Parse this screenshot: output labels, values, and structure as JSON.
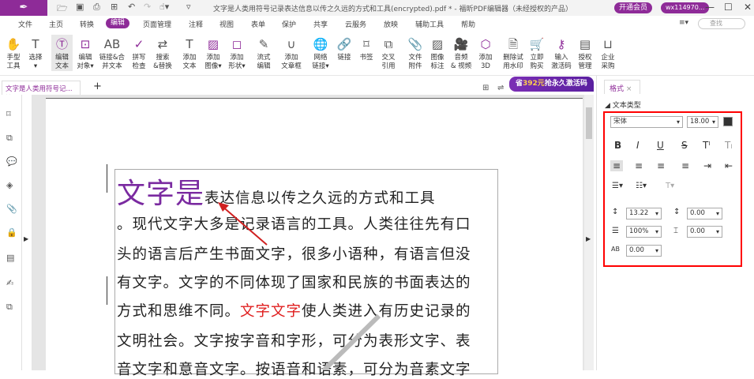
{
  "titlebar": {
    "title": "文字是人类用符号记录表达信息以传之久远的方式和工具(encrypted).pdf * - 福昕PDF编辑器（未经授权的产品）",
    "vip": "开通会员",
    "user": "wx114970..."
  },
  "menu": [
    "文件",
    "主页",
    "转换",
    "编辑",
    "页面管理",
    "注释",
    "视图",
    "表单",
    "保护",
    "共享",
    "云服务",
    "放映",
    "辅助工具",
    "帮助"
  ],
  "search_placeholder": "查找",
  "tools": [
    [
      "手型",
      "工具"
    ],
    [
      "选择",
      "▾"
    ],
    [
      "编辑",
      "文本"
    ],
    [
      "编辑",
      "对象▾"
    ],
    [
      "链接&合",
      "并文本"
    ],
    [
      "拼写",
      "检查"
    ],
    [
      "搜索",
      "&替换"
    ],
    [
      "添加",
      "文本"
    ],
    [
      "添加",
      "图像▾"
    ],
    [
      "添加",
      "形状▾"
    ],
    [
      "流式",
      "编辑"
    ],
    [
      "添加",
      "文章框"
    ],
    [
      "网络",
      "链接▾"
    ],
    [
      "链接",
      ""
    ],
    [
      "书签",
      ""
    ],
    [
      "交叉",
      "引用"
    ],
    [
      "文件",
      "附件"
    ],
    [
      "图像",
      "标注"
    ],
    [
      "音频",
      "& 视频"
    ],
    [
      "添加",
      "3D"
    ],
    [
      "删除试",
      "用水印"
    ],
    [
      "立即",
      "购买"
    ],
    [
      "输入",
      "激活码"
    ],
    [
      "授权",
      "管理"
    ],
    [
      "企业",
      "采购"
    ]
  ],
  "doc_tab": "文字是人类用符号记...",
  "promo": {
    "prefix": "省",
    "amount": "392元",
    "suffix": "抢永久激活码"
  },
  "doc": {
    "big": "文字是",
    "l1": "表达信息以传之久远的方式和工具",
    "l2": "。现代文字大多是记录语言的工具。人类往往先有口",
    "l3": "头的语言后产生书面文字，很多小语种，有语言但没",
    "l4": "有文字。文字的不同体现了国家和民族的书面表达的",
    "l5a": "方式和思维不同。",
    "l5b": "文字文字",
    "l5c": "使人类进入有历史记录的",
    "l6": "文明社会。文字按字音和字形，可分为表形文字、表",
    "l7": "音文字和意音文字。按语音和语素，可分为音素文字"
  },
  "panel": {
    "tab": "格式",
    "section": "文本类型",
    "font": "宋体",
    "size": "18.00",
    "line_spacing": "13.22",
    "para_spacing": "0.00",
    "scale": "100%",
    "baseline": "0.00",
    "char_spacing": "0.00"
  }
}
